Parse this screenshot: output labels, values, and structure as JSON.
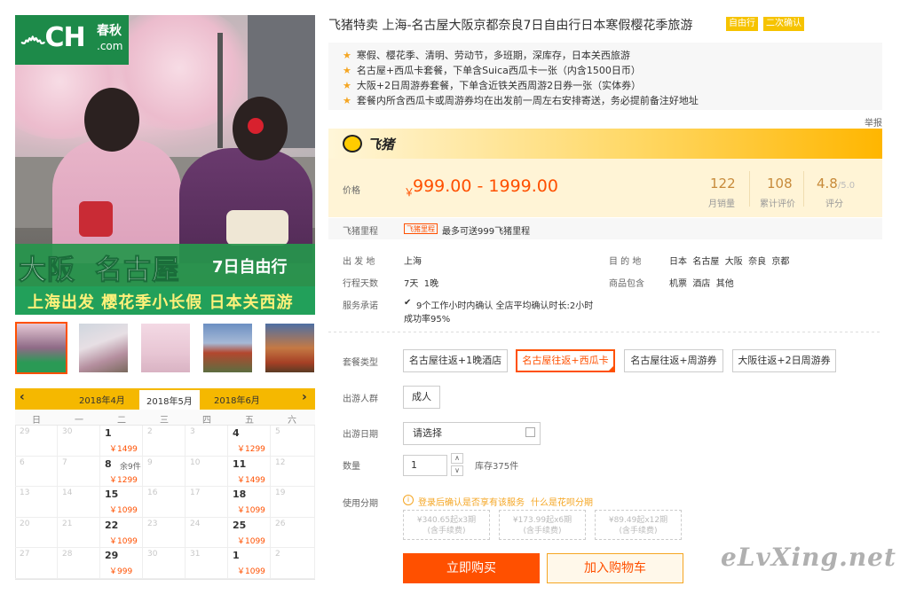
{
  "hero": {
    "logo_mark": "෴CH",
    "logo_cn": "春秋",
    "logo_com": ".com",
    "line1a": "大阪",
    "line1b": "名古屋",
    "line1c": "7日自由行",
    "line2": "上海出发 樱花季小长假 日本关西游"
  },
  "calendar": {
    "prev_month": "2018年4月",
    "cur_month": "2018年5月",
    "next_month": "2018年6月",
    "weekdays": [
      "日",
      "一",
      "二",
      "三",
      "四",
      "五",
      "六"
    ],
    "rows": [
      [
        {
          "d": "29"
        },
        {
          "d": "30"
        },
        {
          "d": "1",
          "p": "￥1499",
          "on": true
        },
        {
          "d": "2"
        },
        {
          "d": "3"
        },
        {
          "d": "4",
          "p": "￥1299",
          "on": true
        },
        {
          "d": "5"
        }
      ],
      [
        {
          "d": "6"
        },
        {
          "d": "7"
        },
        {
          "d": "8",
          "n": "余9件",
          "p": "￥1299",
          "on": true
        },
        {
          "d": "9"
        },
        {
          "d": "10"
        },
        {
          "d": "11",
          "p": "￥1499",
          "on": true
        },
        {
          "d": "12"
        }
      ],
      [
        {
          "d": "13"
        },
        {
          "d": "14"
        },
        {
          "d": "15",
          "p": "￥1099",
          "on": true
        },
        {
          "d": "16"
        },
        {
          "d": "17"
        },
        {
          "d": "18",
          "p": "￥1099",
          "on": true
        },
        {
          "d": "19"
        }
      ],
      [
        {
          "d": "20"
        },
        {
          "d": "21"
        },
        {
          "d": "22",
          "p": "￥1099",
          "on": true
        },
        {
          "d": "23"
        },
        {
          "d": "24"
        },
        {
          "d": "25",
          "p": "￥1099",
          "on": true
        },
        {
          "d": "26"
        }
      ],
      [
        {
          "d": "27"
        },
        {
          "d": "28"
        },
        {
          "d": "29",
          "p": "￥999",
          "on": true
        },
        {
          "d": "30"
        },
        {
          "d": "31"
        },
        {
          "d": "1",
          "p": "￥1099",
          "on": true
        },
        {
          "d": "2"
        }
      ]
    ]
  },
  "product": {
    "title": "飞猪特卖 上海-名古屋大阪京都奈良7日自由行日本寒假樱花季旅游",
    "badge1": "自由行",
    "badge2": "二次确认",
    "notes": [
      "寒假、樱花季、清明、劳动节，多班期，深库存，日本关西旅游",
      "名古屋+西瓜卡套餐，下单含Suica西瓜卡一张（内含1500日币）",
      "大阪+2日周游券套餐，下单含近铁关西周游2日券一张（实体券）",
      "套餐内所含西瓜卡或周游券均在出发前一周左右安排寄送，务必提前备注好地址"
    ],
    "report": "举报"
  },
  "fliggy": {
    "logo_text": "飞猪"
  },
  "price": {
    "label": "价格",
    "symbol": "￥",
    "value": "999.00 - 1999.00",
    "monthly_sales": "122",
    "monthly_sales_label": "月销量",
    "reviews": "108",
    "reviews_label": "累计评价",
    "score": "4.8",
    "score_max": "/5.0",
    "score_label": "评分"
  },
  "miles": {
    "label": "飞猪里程",
    "tag": "飞猪里程",
    "text": "最多可送999飞猪里程"
  },
  "info": {
    "depart_label": "出 发 地",
    "depart": "上海",
    "dest_label": "目 的 地",
    "dest": "日本  名古屋  大阪  奈良  京都",
    "days_label": "行程天数",
    "days": "7天  1晚",
    "incl_label": "商品包含",
    "incl": "机票  酒店  其他",
    "promise_label": "服务承诺",
    "promise_line1": "9个工作小时内确认 全店平均确认时长:2小时",
    "promise_line2": "成功率95%"
  },
  "options": {
    "package_label": "套餐类型",
    "packages": [
      "名古屋往返+1晚酒店",
      "名古屋往返+西瓜卡",
      "名古屋往返+周游券",
      "大阪往返+2日周游券"
    ],
    "selected_index": 1,
    "people_label": "出游人群",
    "people": "成人",
    "date_label": "出游日期",
    "date_placeholder": "请选择",
    "qty_label": "数量",
    "qty": "1",
    "qty_up": "∧",
    "qty_down": "∨",
    "stock": "库存375件",
    "inst_label": "使用分期",
    "inst_info": "登录后确认是否享有该服务",
    "inst_link": "什么是花呗分期",
    "installments": [
      {
        "top": "¥340.65起x3期",
        "sub": "(含手续费)"
      },
      {
        "top": "¥173.99起x6期",
        "sub": "(含手续费)"
      },
      {
        "top": "¥89.49起x12期",
        "sub": "(含手续费)"
      }
    ]
  },
  "actions": {
    "buy": "立即购买",
    "cart": "加入购物车"
  },
  "watermark": "eLvXing.net",
  "colors": {
    "accent": "#ff5000",
    "brand_yellow": "#ffcc00",
    "cal_header": "#f5b800",
    "hero_green": "#22a05a"
  }
}
